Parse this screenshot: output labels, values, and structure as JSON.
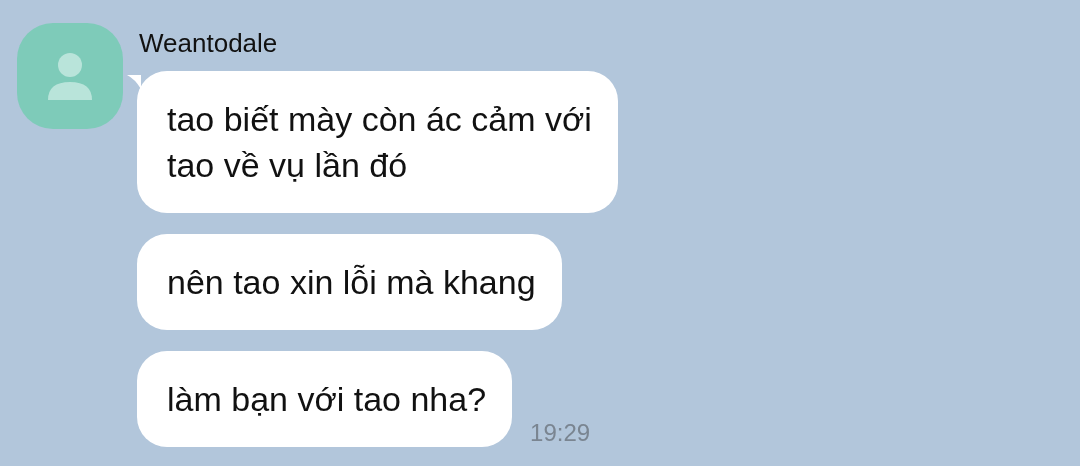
{
  "sender": {
    "name": "Weantodale"
  },
  "messages": [
    {
      "text": "tao biết mày còn ác cảm với\ntao về vụ lần đó"
    },
    {
      "text": "nên tao xin lỗi mà khang"
    },
    {
      "text": "làm bạn với tao nha?"
    }
  ],
  "time": "19:29"
}
